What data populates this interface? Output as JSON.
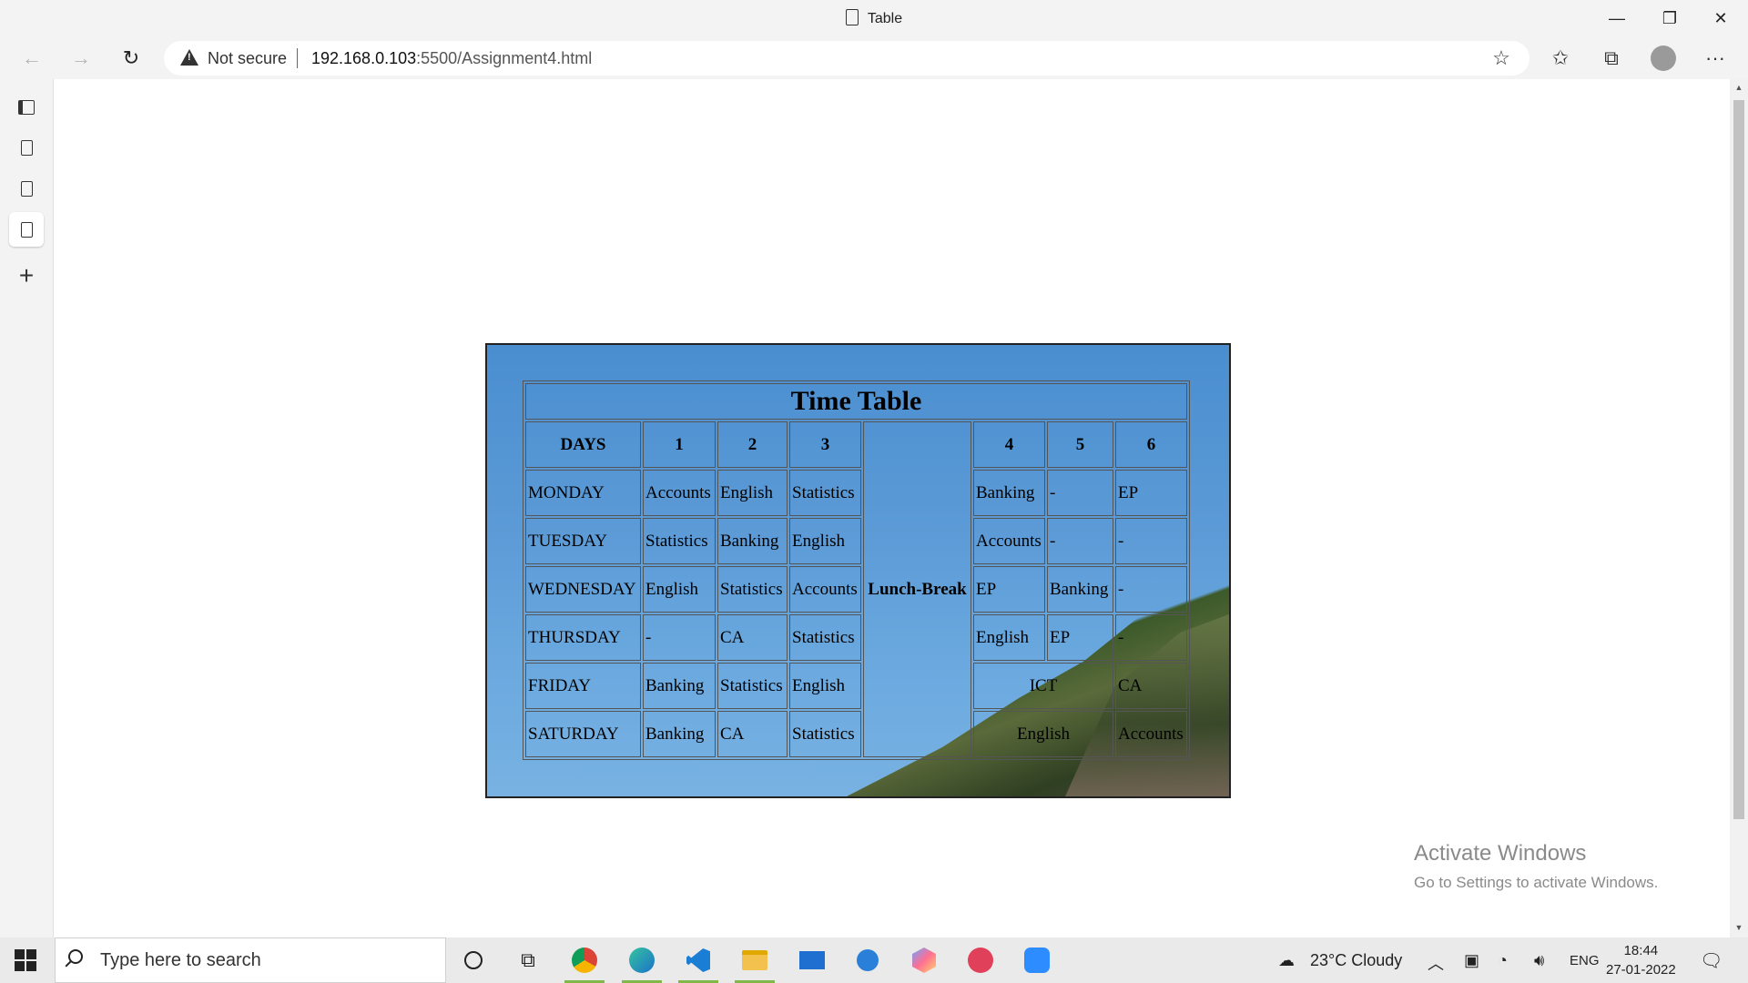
{
  "window": {
    "title": "Table",
    "minimize": "—",
    "restore": "❐",
    "close": "✕"
  },
  "toolbar": {
    "back": "←",
    "forward": "→",
    "refresh": "↻",
    "security_label": "Not secure",
    "url_host": "192.168.0.103",
    "url_rest": ":5500/Assignment4.html",
    "favorites_add": "☆",
    "favorites": "✩",
    "collections": "⧉",
    "menu": "···"
  },
  "sidebar": {
    "new_tab": "+"
  },
  "timetable": {
    "caption": "Time Table",
    "headers": [
      "DAYS",
      "1",
      "2",
      "3",
      "4",
      "5",
      "6"
    ],
    "lunch": "Lunch-Break",
    "rows": [
      {
        "day": "MONDAY",
        "p1": "Accounts",
        "p2": "English",
        "p3": "Statistics",
        "p4": "Banking",
        "p5": "-",
        "p6": "EP"
      },
      {
        "day": "TUESDAY",
        "p1": "Statistics",
        "p2": "Banking",
        "p3": "English",
        "p4": "Accounts",
        "p5": "-",
        "p6": "-"
      },
      {
        "day": "WEDNESDAY",
        "p1": "English",
        "p2": "Statistics",
        "p3": "Accounts",
        "p4": "EP",
        "p5": "Banking",
        "p6": "-"
      },
      {
        "day": "THURSDAY",
        "p1": "-",
        "p2": "CA",
        "p3": "Statistics",
        "p4": "English",
        "p5": "EP",
        "p6": "-"
      },
      {
        "day": "FRIDAY",
        "p1": "Banking",
        "p2": "Statistics",
        "p3": "English",
        "p45": "ICT",
        "p6": "CA"
      },
      {
        "day": "SATURDAY",
        "p1": "Banking",
        "p2": "CA",
        "p3": "Statistics",
        "p45": "English",
        "p6": "Accounts"
      }
    ]
  },
  "watermark": {
    "line1": "Activate Windows",
    "line2": "Go to Settings to activate Windows."
  },
  "taskbar": {
    "search_placeholder": "Type here to search",
    "weather": "23°C  Cloudy",
    "language": "ENG",
    "time": "18:44",
    "date": "27-01-2022"
  },
  "colors": {
    "accent_running": "#82b84a",
    "table_bg_top": "#4a8ed0"
  }
}
